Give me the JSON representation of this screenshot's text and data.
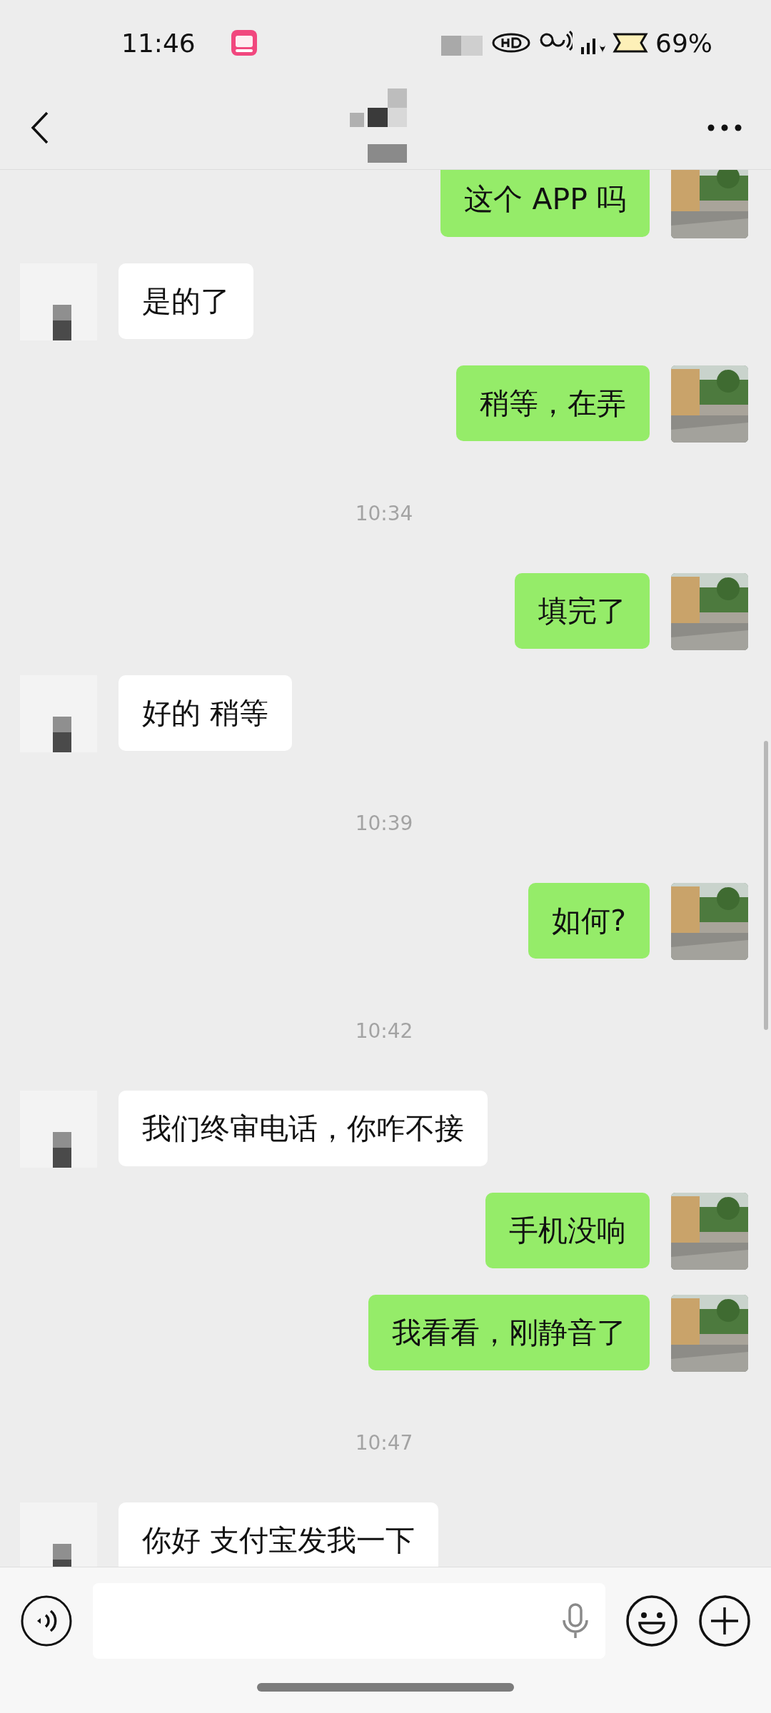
{
  "status_bar": {
    "time": "11:46",
    "battery": "69%"
  },
  "messages": [
    {
      "kind": "sent",
      "text": "这个 APP 吗"
    },
    {
      "kind": "received",
      "text": "是的了"
    },
    {
      "kind": "sent",
      "text": "稍等，在弄"
    },
    {
      "kind": "time",
      "text": "10:34"
    },
    {
      "kind": "sent",
      "text": "填完了"
    },
    {
      "kind": "received",
      "text": "好的 稍等"
    },
    {
      "kind": "time",
      "text": "10:39"
    },
    {
      "kind": "sent",
      "text": "如何?"
    },
    {
      "kind": "time",
      "text": "10:42"
    },
    {
      "kind": "received",
      "text": "我们终审电话，你咋不接"
    },
    {
      "kind": "sent",
      "text": "手机没响"
    },
    {
      "kind": "sent",
      "text": "我看看，刚静音了"
    },
    {
      "kind": "time",
      "text": "10:47"
    },
    {
      "kind": "received",
      "text": "你好 支付宝发我一下"
    }
  ]
}
